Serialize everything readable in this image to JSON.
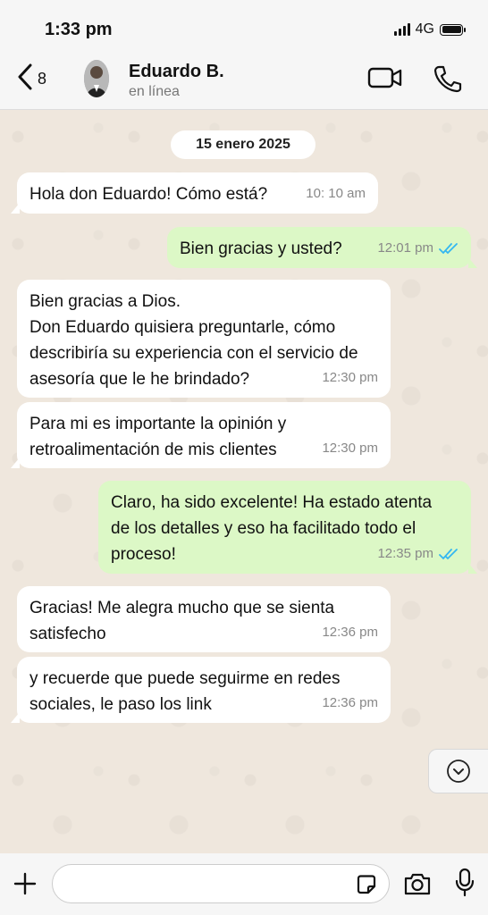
{
  "status_bar": {
    "time": "1:33 pm",
    "network": "4G"
  },
  "header": {
    "back_count": "8",
    "contact_name": "Eduardo B.",
    "contact_status": "en línea"
  },
  "chat": {
    "date_separator": "15 enero 2025",
    "messages": [
      {
        "direction": "in",
        "text": "Hola don Eduardo! Cómo está?",
        "time": "10: 10 am"
      },
      {
        "direction": "out",
        "text": "Bien gracias y usted?",
        "time": "12:01 pm",
        "read": true
      },
      {
        "direction": "in",
        "text": "Bien gracias a Dios.\nDon Eduardo quisiera preguntarle, cómo describiría su experiencia con el servicio de asesoría que le he brindado?",
        "time": "12:30 pm"
      },
      {
        "direction": "in",
        "text": "Para mi es importante la opinión y retroalimentación de mis clientes",
        "time": "12:30 pm"
      },
      {
        "direction": "out",
        "text": "Claro, ha sido excelente! Ha estado atenta de los detalles y eso ha facilitado todo el proceso!",
        "time": "12:35 pm",
        "read": true
      },
      {
        "direction": "in",
        "text": "Gracias! Me alegra mucho que se sienta satisfecho",
        "time": "12:36 pm"
      },
      {
        "direction": "in",
        "text": "y recuerde que puede seguirme en redes sociales, le paso los link",
        "time": "12:36 pm"
      }
    ]
  },
  "input_bar": {
    "message_value": "",
    "placeholder": ""
  },
  "colors": {
    "incoming_bubble": "#ffffff",
    "outgoing_bubble": "#dcf8c6",
    "read_ticks": "#34b7f1",
    "chat_background": "#efe7dd"
  },
  "icons": [
    "back-chevron-icon",
    "video-call-icon",
    "phone-icon",
    "double-check-icon",
    "chevron-down-icon",
    "plus-icon",
    "sticker-icon",
    "camera-icon",
    "microphone-icon",
    "signal-icon",
    "battery-icon"
  ]
}
